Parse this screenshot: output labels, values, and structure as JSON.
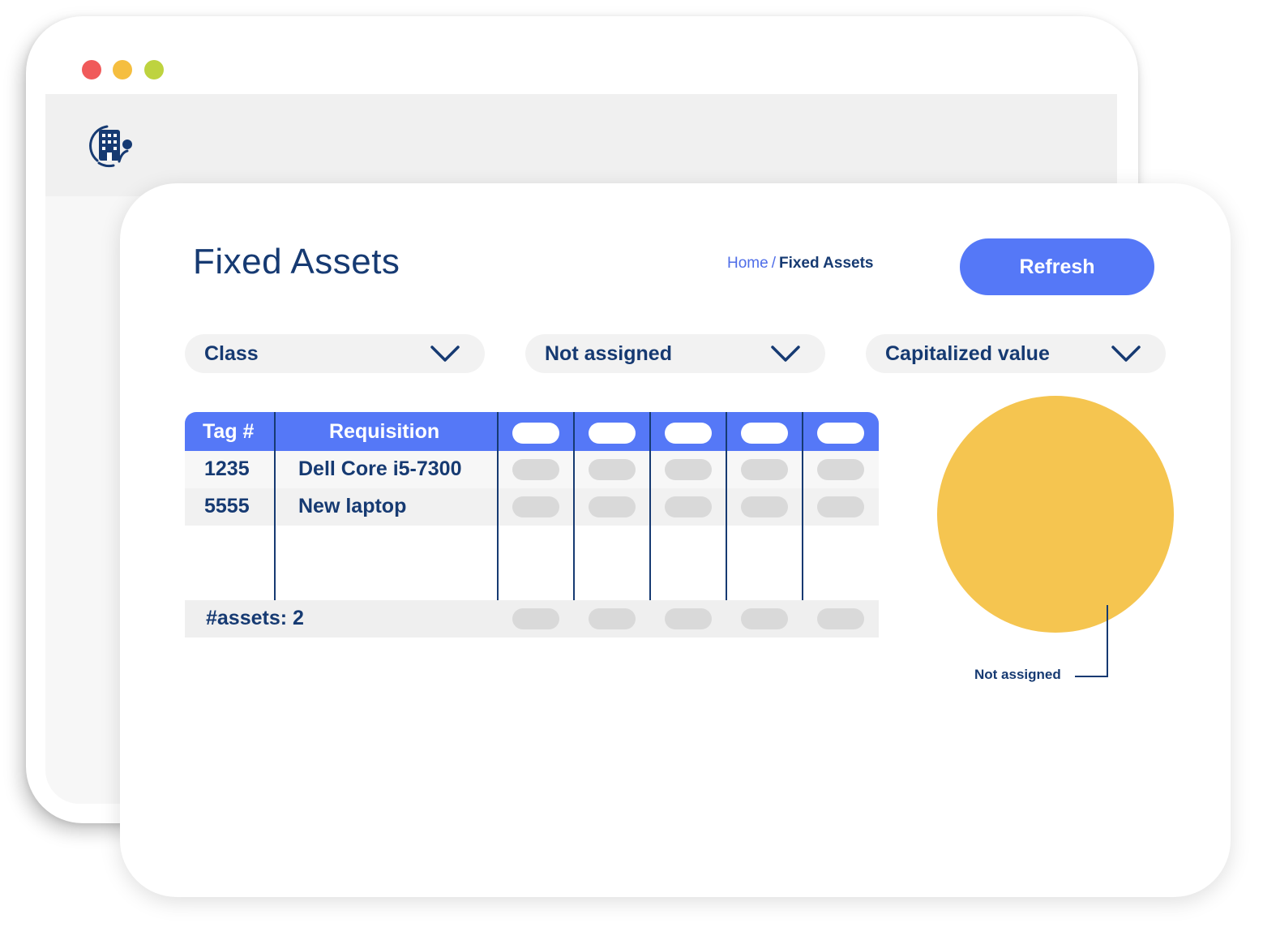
{
  "window": {
    "traffic_lights": [
      "close",
      "minimize",
      "maximize"
    ],
    "logo_icon": "building-icon"
  },
  "page": {
    "title": "Fixed Assets",
    "breadcrumb": {
      "home": "Home",
      "separator": "/",
      "current": "Fixed Assets"
    },
    "refresh_label": "Refresh"
  },
  "filters": [
    {
      "label": "Class",
      "icon": "chevron-down-icon"
    },
    {
      "label": "Not assigned",
      "icon": "chevron-down-icon"
    },
    {
      "label": "Capitalized value",
      "icon": "chevron-down-icon"
    }
  ],
  "table": {
    "headers": [
      "Tag #",
      "Requisition"
    ],
    "rows": [
      {
        "tag": "1235",
        "requisition": "Dell Core i5-7300"
      },
      {
        "tag": "5555",
        "requisition": "New laptop"
      }
    ],
    "footer": "#assets: 2"
  },
  "chart_data": {
    "type": "pie",
    "slices": [
      {
        "label": "Not assigned",
        "value": 100,
        "color": "#f5c550"
      }
    ]
  },
  "colors": {
    "accent": "#5578f7",
    "text": "#163a72",
    "pie": "#f5c550"
  }
}
